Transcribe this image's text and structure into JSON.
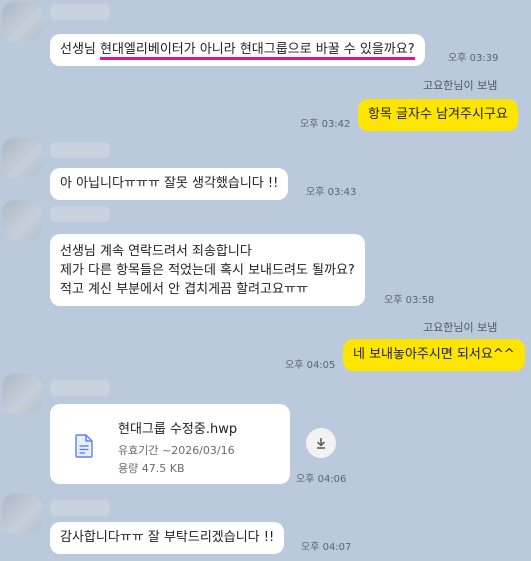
{
  "messages": [
    {
      "text_before": "선생님 ",
      "text_highlight": "현대엘리베이터가 아니라 현대그룹으로 바꿀 수 있을까요?",
      "time": "오후 03:39"
    },
    {
      "sender": "고요한님이 보냄",
      "text": "항목 글자수 남겨주시구요",
      "time": "오후 03:42"
    },
    {
      "text": "아 아닙니다ㅠㅠㅠ 잘못 생각했습니다 !!",
      "time": "오후 03:43"
    },
    {
      "lines": [
        "선생님 계속 연락드려서 죄송합니다",
        "제가 다른 항목들은 적었는데 혹시 보내드려도 될까요?",
        "적고 계신 부분에서 안 겹치게끔 할려고요ㅠㅠ"
      ],
      "time": "오후 03:58"
    },
    {
      "sender": "고요한님이 보냄",
      "text": "네 보내놓아주시면 되서요^^",
      "time": "오후 04:05"
    },
    {
      "file": {
        "name": "현대그룹 수정중.hwp",
        "expiry": "유효기간 ~2026/03/16",
        "size": "용량 47.5 KB"
      },
      "time": "오후 04:06"
    },
    {
      "text": "감사합니다ㅠㅠ 잘 부탁드리겠습니다 !!",
      "time": "오후 04:07"
    }
  ],
  "colors": {
    "background": "#bac9dc",
    "my_bubble": "#fee500",
    "other_bubble": "#ffffff",
    "highlight_underline": "#e0138c"
  },
  "icons": {
    "file": "document-icon",
    "download": "download-icon"
  }
}
